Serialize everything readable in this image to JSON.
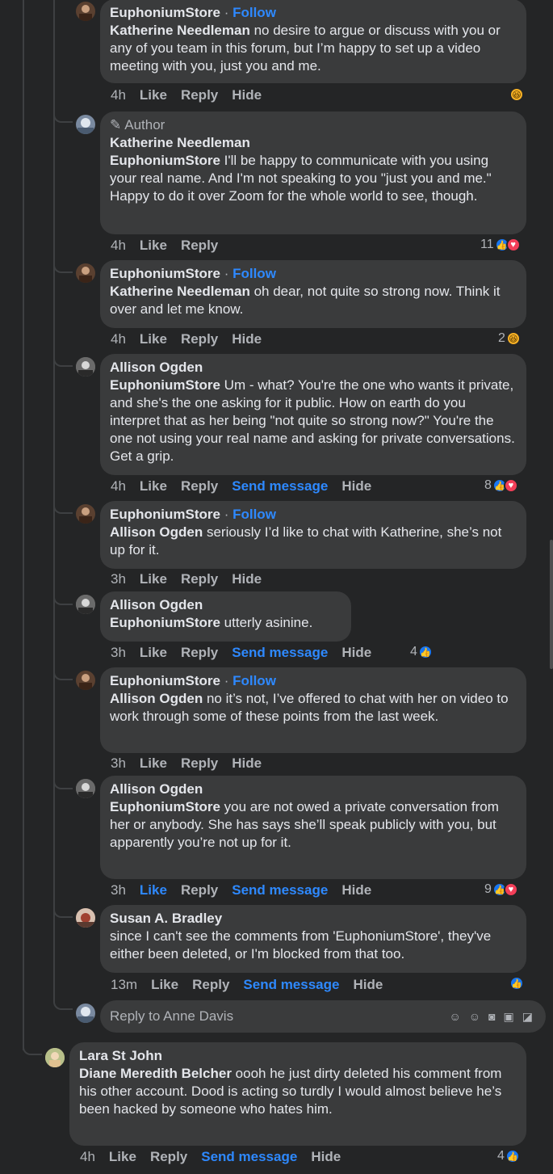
{
  "labels": {
    "like": "Like",
    "reply": "Reply",
    "hide": "Hide",
    "send_message": "Send message",
    "follow": "Follow",
    "dot": "·",
    "author_badge": "Author"
  },
  "colors": {
    "accent": "#2e89ff",
    "bubble": "#3a3b3c",
    "bg": "#242526"
  },
  "comments": [
    {
      "author": "EuphoniumStore",
      "mention": "Katherine Needleman",
      "text": " no desire to argue or discuss with you or any of you team in this forum, but I’m happy to set up a video meeting with you, just you and me.",
      "time": "4h",
      "reaction_count": ""
    },
    {
      "author": "Katherine Needleman",
      "mention": "EuphoniumStore",
      "text": " I'll be happy to communicate with you using your real name. And I'm not speaking to you \"just you and me.\" Happy to do it over Zoom for the whole world to see, though.",
      "time": "4h",
      "reaction_count": "11"
    },
    {
      "author": "EuphoniumStore",
      "mention": "Katherine Needleman",
      "text": " oh dear, not quite so strong now. Think it over and let me know.",
      "time": "4h",
      "reaction_count": "2"
    },
    {
      "author": "Allison Ogden",
      "mention": "EuphoniumStore",
      "text": " Um - what? You're the one who wants it private, and she's the one asking for it public. How on earth do you interpret that as her being \"not quite so strong now?\" You're the one not using your real name and asking for private conversations. Get a grip.",
      "time": "4h",
      "reaction_count": "8"
    },
    {
      "author": "EuphoniumStore",
      "mention": "Allison Ogden",
      "text": " seriously I’d like to chat with Katherine, she’s not up for it.",
      "time": "3h",
      "reaction_count": ""
    },
    {
      "author": "Allison Ogden",
      "mention": "EuphoniumStore",
      "text": " utterly asinine.",
      "time": "3h",
      "reaction_count": "4"
    },
    {
      "author": "EuphoniumStore",
      "mention": "Allison Ogden",
      "text": " no it’s not, I’ve offered to chat with her on video to work through some of these points from the last week.",
      "time": "3h",
      "reaction_count": ""
    },
    {
      "author": "Allison Ogden",
      "mention": "EuphoniumStore",
      "text": " you are not owed a private conversation from her or anybody. She has says she’ll speak publicly with you, but apparently you’re not up for it.",
      "time": "3h",
      "reaction_count": "9"
    },
    {
      "author": "Susan A. Bradley",
      "mention": "",
      "text": "since I can't see the comments from 'EuphoniumStore', they've either been deleted, or I'm blocked from that too.",
      "time": "13m",
      "reaction_count": ""
    },
    {
      "author": "Lara St John",
      "mention": "Diane Meredith Belcher",
      "text": " oooh he just dirty deleted his comment from his other account. Dood is acting so turdly I would almost believe he’s been hacked by someone who hates him.",
      "time": "4h",
      "reaction_count": "4"
    }
  ],
  "reply_box": {
    "placeholder": "Reply to Anne Davis"
  },
  "icons": [
    "avatar-sticker-icon",
    "emoji-icon",
    "camera-icon",
    "gif-icon",
    "sticker-icon"
  ]
}
